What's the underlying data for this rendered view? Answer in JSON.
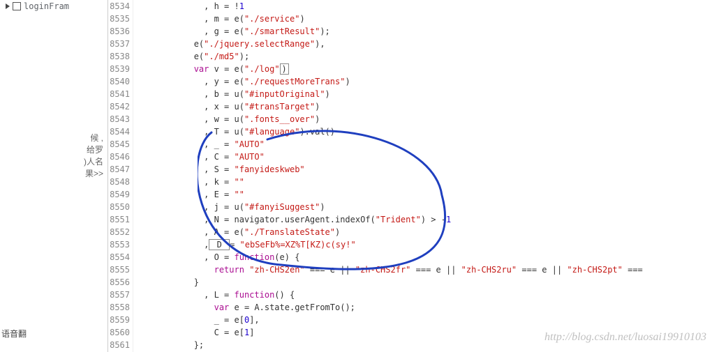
{
  "sidebar": {
    "item": "loginFram",
    "hints": [
      "候 ,",
      "给罗",
      ")人名",
      "果>>"
    ],
    "bottom": "语音翻"
  },
  "gutter": {
    "start": 8534,
    "end": 8561
  },
  "code": {
    "l8534": [
      "              , h = !",
      "1"
    ],
    "l8535": [
      "              , m = e(",
      "\"./service\"",
      ")"
    ],
    "l8536": [
      "              , g = e(",
      "\"./smartResult\"",
      ");"
    ],
    "l8537": [
      "            e(",
      "\"./jquery.selectRange\"",
      "),"
    ],
    "l8538": [
      "            e(",
      "\"./md5\"",
      ");"
    ],
    "l8539": [
      "            ",
      "var",
      " v = e(",
      "\"./log\"",
      ")"
    ],
    "l8540": [
      "              , y = e(",
      "\"./requestMoreTrans\"",
      ")"
    ],
    "l8541": [
      "              , b = u(",
      "\"#inputOriginal\"",
      ")"
    ],
    "l8542": [
      "              , x = u(",
      "\"#transTarget\"",
      ")"
    ],
    "l8543": [
      "              , w = u(",
      "\".fonts__over\"",
      ")"
    ],
    "l8544": [
      "              , T = u(",
      "\"#language\"",
      ").val()"
    ],
    "l8545": [
      "              , _ = ",
      "\"AUTO\""
    ],
    "l8546": [
      "              , C = ",
      "\"AUTO\""
    ],
    "l8547": [
      "              , S = ",
      "\"fanyideskweb\""
    ],
    "l8548": [
      "              , k = ",
      "\"\""
    ],
    "l8549": [
      "              , E = ",
      "\"\""
    ],
    "l8550": [
      "              , j = u(",
      "\"#fanyiSuggest\"",
      ")"
    ],
    "l8551": [
      "              , N = navigator.userAgent.indexOf(",
      "\"Trident\"",
      ") > -",
      "1"
    ],
    "l8552": [
      "              , A = e(",
      "\"./TranslateState\"",
      ")"
    ],
    "l8553": [
      "              ,",
      " D ",
      "= ",
      "\"ebSeFb%=XZ%T[KZ)c(sy!\""
    ],
    "l8554": [
      "              , O = ",
      "function",
      "(e) {"
    ],
    "l8555": [
      "                ",
      "return",
      " ",
      "\"zh-CHS2en\"",
      " === e || ",
      "\"zh-CHS2fr\"",
      " === e || ",
      "\"zh-CHS2ru\"",
      " === e || ",
      "\"zh-CHS2pt\"",
      " ==="
    ],
    "l8556": [
      "            }"
    ],
    "l8557": [
      "              , L = ",
      "function",
      "() {"
    ],
    "l8558": [
      "                ",
      "var",
      " e = A.state.getFromTo();"
    ],
    "l8559": [
      "                _ = e[",
      "0",
      "],"
    ],
    "l8560": [
      "                C = e[",
      "1",
      "]"
    ],
    "l8561": [
      "            };"
    ]
  },
  "watermark": "http://blog.csdn.net/luosai19910103"
}
